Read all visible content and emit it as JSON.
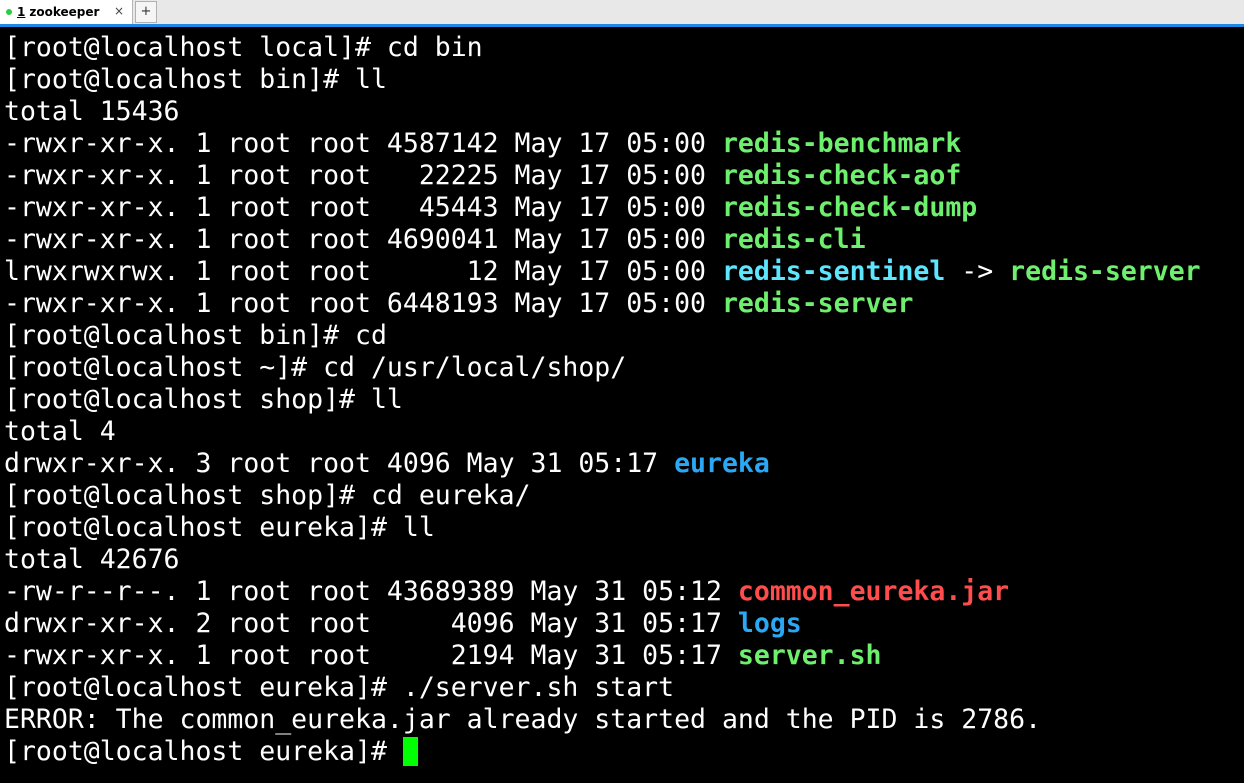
{
  "tab": {
    "number": "1",
    "title": "zookeeper",
    "close": "×",
    "new_tab": "+"
  },
  "colors": {
    "executable": "#6ef06e",
    "symlink": "#5fe6ff",
    "directory": "#2aa8f5",
    "archive": "#ff4d4d",
    "cursor": "#00ff00"
  },
  "terminal": {
    "lines": [
      {
        "text": "[root@localhost local]# cd bin"
      },
      {
        "text": "[root@localhost bin]# ll"
      },
      {
        "text": "total 15436"
      },
      {
        "text": "-rwxr-xr-x. 1 root root 4587142 May 17 05:00 ",
        "file": "redis-benchmark"
      },
      {
        "text": "-rwxr-xr-x. 1 root root   22225 May 17 05:00 ",
        "file": "redis-check-aof"
      },
      {
        "text": "-rwxr-xr-x. 1 root root   45443 May 17 05:00 ",
        "file": "redis-check-dump"
      },
      {
        "text": "-rwxr-xr-x. 1 root root 4690041 May 17 05:00 ",
        "file": "redis-cli"
      },
      {
        "text": "lrwxrwxrwx. 1 root root      12 May 17 05:00 ",
        "file": "redis-sentinel",
        "arrow": " -> ",
        "target": "redis-server"
      },
      {
        "text": "-rwxr-xr-x. 1 root root 6448193 May 17 05:00 ",
        "file": "redis-server"
      },
      {
        "text": "[root@localhost bin]# cd"
      },
      {
        "text": "[root@localhost ~]# cd /usr/local/shop/"
      },
      {
        "text": "[root@localhost shop]# ll"
      },
      {
        "text": "total 4"
      },
      {
        "text": "drwxr-xr-x. 3 root root 4096 May 31 05:17 ",
        "file": "eureka"
      },
      {
        "text": "[root@localhost shop]# cd eureka/"
      },
      {
        "text": "[root@localhost eureka]# ll"
      },
      {
        "text": "total 42676"
      },
      {
        "text": "-rw-r--r--. 1 root root 43689389 May 31 05:12 ",
        "file": "common_eureka.jar"
      },
      {
        "text": "drwxr-xr-x. 2 root root     4096 May 31 05:17 ",
        "file": "logs"
      },
      {
        "text": "-rwxr-xr-x. 1 root root     2194 May 31 05:17 ",
        "file": "server.sh"
      },
      {
        "text": "[root@localhost eureka]# ./server.sh start"
      },
      {
        "text": "ERROR: The common_eureka.jar already started and the PID is 2786."
      },
      {
        "text": "[root@localhost eureka]# "
      }
    ]
  }
}
